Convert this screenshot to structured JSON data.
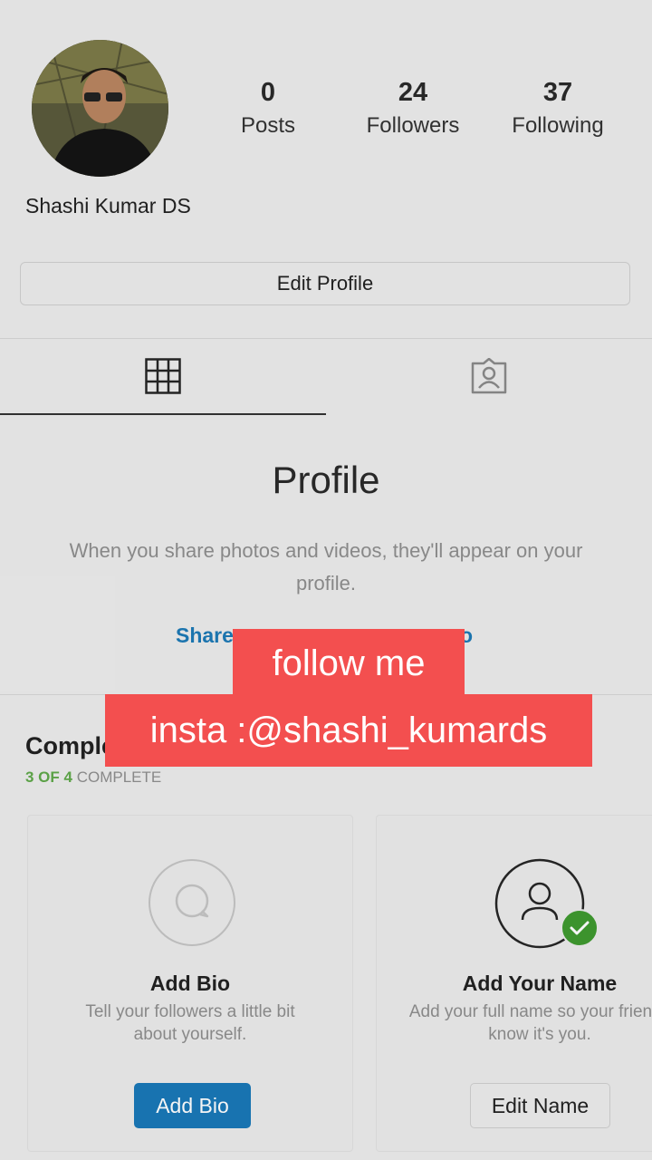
{
  "profile": {
    "username": "Shashi Kumar DS",
    "stats": [
      {
        "value": "0",
        "label": "Posts"
      },
      {
        "value": "24",
        "label": "Followers"
      },
      {
        "value": "37",
        "label": "Following"
      }
    ],
    "edit_profile_label": "Edit Profile"
  },
  "tabs": {
    "grid_icon": "grid-icon",
    "tagged_icon": "tagged-person-icon",
    "active": "grid"
  },
  "empty_state": {
    "title": "Profile",
    "body": "When you share photos and videos, they'll appear on your profile.",
    "link_start": "Share",
    "link_end": "o"
  },
  "complete_profile": {
    "title_visible": "Comple",
    "progress_count": "3 OF 4",
    "progress_suffix": "COMPLETE",
    "cards": [
      {
        "title": "Add Bio",
        "description": "Tell your followers a little bit about yourself.",
        "button_label": "Add Bio",
        "icon": "speech-bubble-icon",
        "completed": false
      },
      {
        "title": "Add Your Name",
        "description": "Add your full name so your friends know it's you.",
        "button_label": "Edit Name",
        "icon": "person-icon",
        "completed": true
      }
    ]
  },
  "overlay": {
    "line1": "follow me",
    "line2": "insta :@shashi_kumards"
  },
  "colors": {
    "link_blue": "#1d79b6",
    "button_blue": "#1a78b8",
    "success_green": "#3f9a2f",
    "caption_red": "#f34f4f"
  }
}
